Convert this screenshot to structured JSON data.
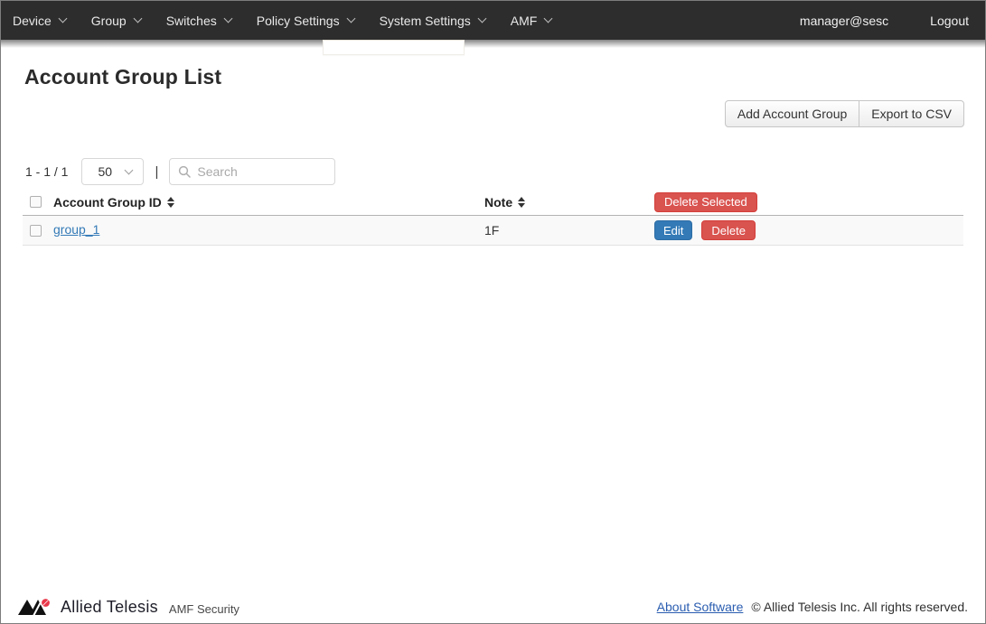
{
  "nav": {
    "items": [
      {
        "label": "Device"
      },
      {
        "label": "Group"
      },
      {
        "label": "Switches"
      },
      {
        "label": "Policy Settings"
      },
      {
        "label": "System Settings"
      },
      {
        "label": "AMF"
      }
    ],
    "user": "manager@sesc",
    "logout": "Logout"
  },
  "page": {
    "title": "Account Group List"
  },
  "actions": {
    "add": "Add Account Group",
    "export": "Export to CSV"
  },
  "toolbar": {
    "range": "1 - 1 / 1",
    "page_size": "50",
    "divider": "|",
    "search_placeholder": "Search"
  },
  "table": {
    "headers": {
      "id": "Account Group ID",
      "note": "Note"
    },
    "delete_selected_label": "Delete Selected",
    "rows": [
      {
        "id": "group_1",
        "note": "1F",
        "edit_label": "Edit",
        "delete_label": "Delete"
      }
    ]
  },
  "footer": {
    "brand": "Allied Telesis",
    "product": "AMF Security",
    "about": "About Software",
    "copyright": "© Allied Telesis Inc. All rights reserved."
  },
  "colors": {
    "navbar": "#2d2d2d",
    "danger": "#d9534f",
    "primary": "#337ab7",
    "link": "#337ab7",
    "row_bg": "#f9f9f9"
  }
}
